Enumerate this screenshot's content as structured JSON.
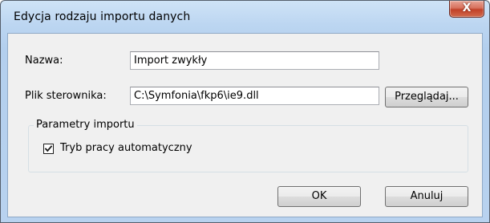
{
  "window": {
    "title": "Edycja rodzaju importu danych",
    "close_glyph": "X"
  },
  "form": {
    "name_label": "Nazwa:",
    "name_value": "Import zwykły",
    "driver_label": "Plik sterownika:",
    "driver_value": "C:\\Symfonia\\fkp6\\ie9.dll",
    "browse_label": "Przeglądaj..."
  },
  "import_params": {
    "group_title": "Parametry importu",
    "auto_mode_label": "Tryb pracy automatyczny",
    "auto_mode_checked": true
  },
  "buttons": {
    "ok_label": "OK",
    "cancel_label": "Anuluj"
  },
  "icons": {
    "close": "close-icon",
    "checkmark": "checkmark-icon"
  },
  "colors": {
    "titlebar": "#bcd6f1",
    "close_button": "#c14229",
    "client_background": "#f0f0f0"
  }
}
